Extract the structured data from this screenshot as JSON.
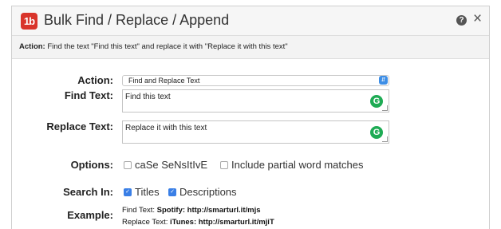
{
  "window": {
    "logo_text": "1b",
    "title": "Bulk Find / Replace / Append",
    "help_glyph": "?",
    "close_glyph": "×"
  },
  "description": {
    "label": "Action:",
    "text": "Find the text \"Find this text\" and replace it with \"Replace it with this text\""
  },
  "form": {
    "action": {
      "label": "Action:",
      "value": "Find and Replace Text"
    },
    "find": {
      "label": "Find Text:",
      "value": "Find this text"
    },
    "replace": {
      "label": "Replace Text:",
      "value": "Replace it with this text"
    },
    "options": {
      "label": "Options:",
      "case_sensitive": {
        "label": "caSe SeNsItIvE",
        "checked": false
      },
      "partial": {
        "label": "Include partial word matches",
        "checked": false
      }
    },
    "search_in": {
      "label": "Search In:",
      "titles": {
        "label": "Titles",
        "checked": true
      },
      "descriptions": {
        "label": "Descriptions",
        "checked": true
      }
    },
    "example": {
      "label": "Example:",
      "line1_prefix": "Find Text: ",
      "line1_value": "Spotify: http://smarturl.it/mjs",
      "line2_prefix": "Replace Text: ",
      "line2_value": "iTunes: http://smarturl.it/mjiT"
    }
  },
  "icons": {
    "grammarly": "grammarly-icon",
    "select_arrow": "chevron-updown-icon"
  },
  "colors": {
    "logo": "#d9342b",
    "checkbox_checked": "#3a7fe6",
    "grammarly": "#1eab54"
  }
}
